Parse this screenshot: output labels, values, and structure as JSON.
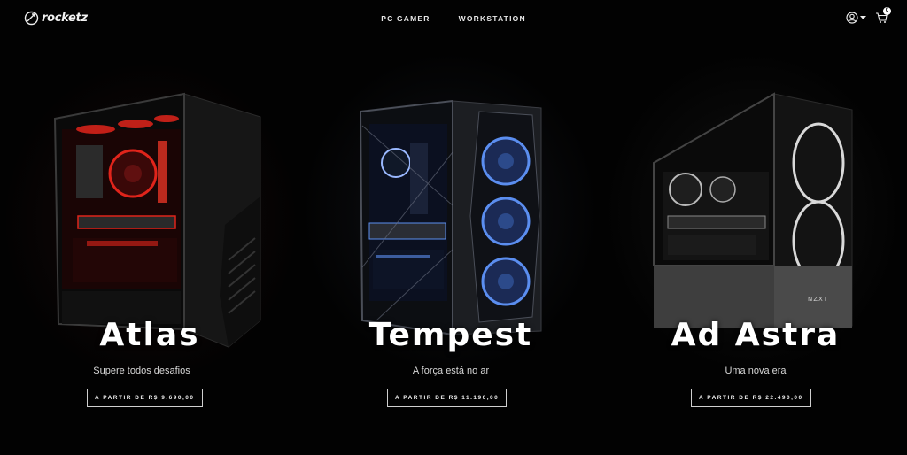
{
  "brand": {
    "name": "rocketz"
  },
  "nav": {
    "items": [
      "PC GAMER",
      "WORKSTATION"
    ]
  },
  "header": {
    "user_icon": "user-icon",
    "cart_icon": "cart-icon",
    "cart_count": "0"
  },
  "products": [
    {
      "title": "Atlas",
      "subtitle": "Supere todos desafios",
      "price": "A PARTIR DE R$ 9.690,00",
      "accent": "#e0241b"
    },
    {
      "title": "Tempest",
      "subtitle": "A força está no ar",
      "price": "A PARTIR DE R$ 11.190,00",
      "accent": "#5b8ef0"
    },
    {
      "title": "Ad Astra",
      "subtitle": "Uma nova era",
      "price": "A PARTIR DE R$ 22.490,00",
      "accent": "#d9d9d9"
    }
  ]
}
